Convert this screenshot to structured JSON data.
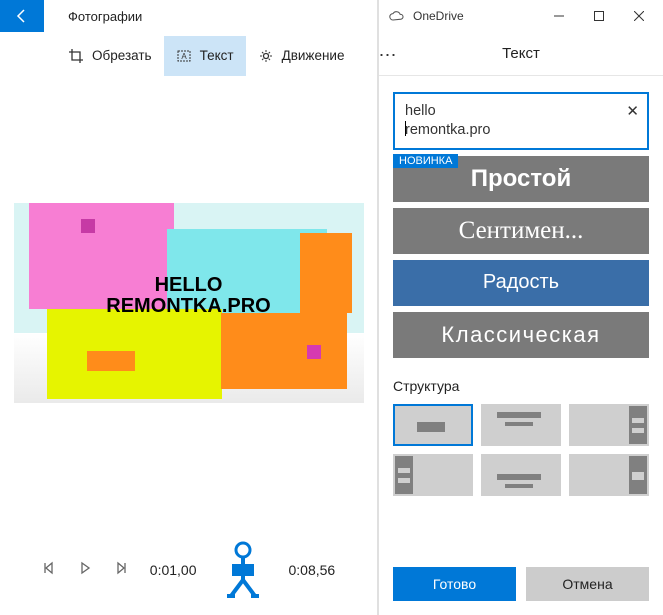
{
  "left": {
    "app_title": "Фотографии",
    "toolbar": {
      "crop": "Обрезать",
      "text": "Текст",
      "motion": "Движение"
    },
    "overlay": {
      "line1": "HELLO",
      "line2": "REMONTKA.PRO"
    },
    "controls": {
      "current_time": "0:01,00",
      "total_time": "0:08,56"
    }
  },
  "right": {
    "onedrive_label": "OneDrive",
    "panel_title": "Текст",
    "text_input": {
      "line1": "hello",
      "line2": "remontka.pro"
    },
    "badge": "НОВИНКА",
    "styles": [
      "Простой",
      "Сентимен...",
      "Радость",
      "Классическая"
    ],
    "structure_label": "Структура",
    "footer": {
      "done": "Готово",
      "cancel": "Отмена"
    }
  }
}
